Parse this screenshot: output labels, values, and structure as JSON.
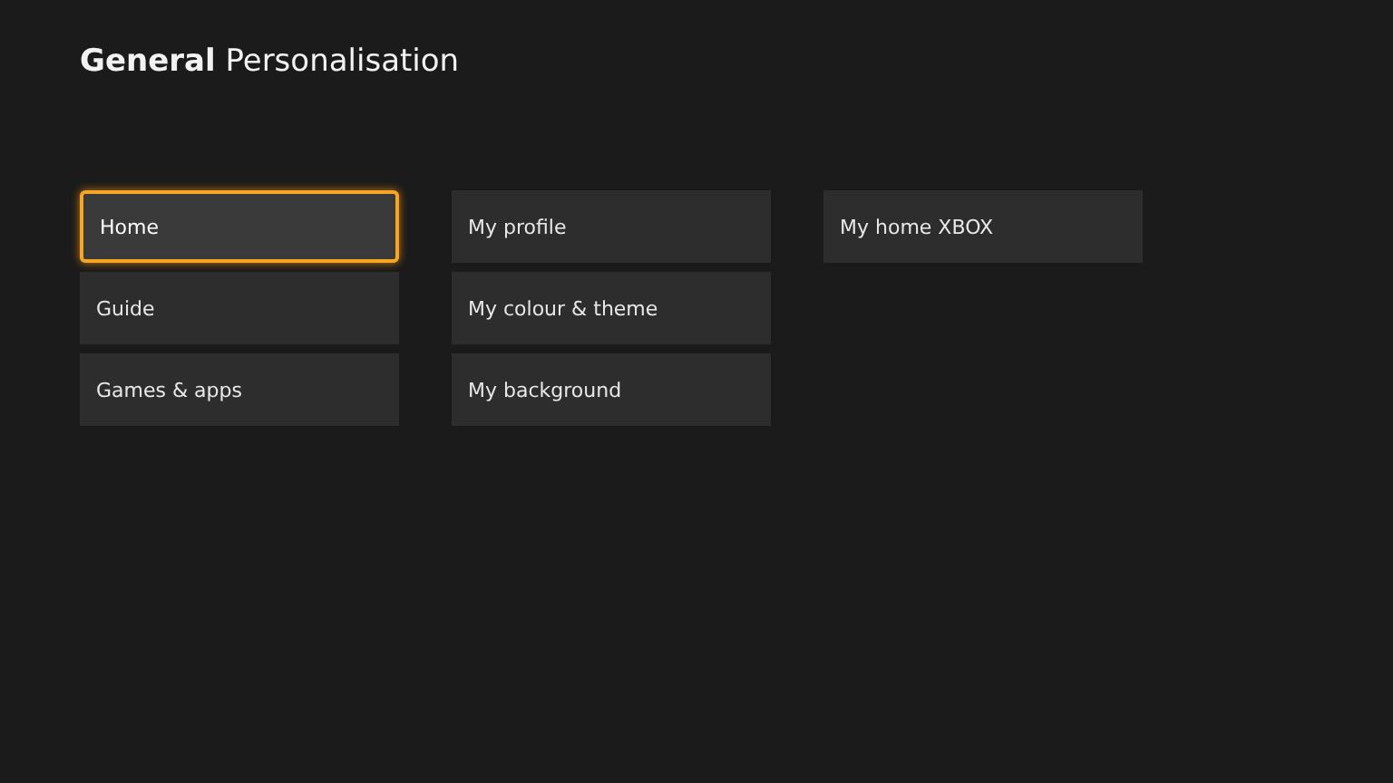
{
  "header": {
    "title": "**General** Personalisation"
  },
  "columns": [
    {
      "items": [
        {
          "label": "Home",
          "selected": true
        },
        {
          "label": "Guide",
          "selected": false
        },
        {
          "label": "Games & apps",
          "selected": false
        }
      ]
    },
    {
      "items": [
        {
          "label": "My profile",
          "selected": false
        },
        {
          "label": "My colour & theme",
          "selected": false
        },
        {
          "label": "My background",
          "selected": false
        }
      ]
    },
    {
      "items": [
        {
          "label": "My home XBOX",
          "selected": false
        }
      ]
    }
  ]
}
